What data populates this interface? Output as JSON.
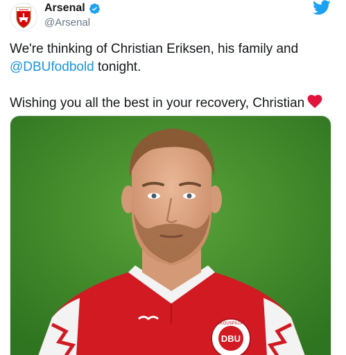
{
  "account": {
    "display_name": "Arsenal",
    "handle": "@Arsenal",
    "avatar_text": "Arsenal"
  },
  "tweet": {
    "line1_text": "We're thinking of Christian Eriksen, his family and",
    "mention": "@DBUfodbold",
    "line2_suffix": " tonight.",
    "line3_text": "Wishing you all the best in your recovery, Christian"
  },
  "media": {
    "badge_text": "DBU",
    "badge_ring_text": "SKOUSPILUN"
  },
  "icons": {
    "verified": "verified-badge-icon",
    "twitter": "twitter-bird-icon",
    "heart": "red-heart-emoji"
  },
  "colors": {
    "twitter_blue": "#1da1f2",
    "mention_blue": "#1b95e0",
    "arsenal_red": "#db0007",
    "shirt_red": "#d11a22",
    "pitch_green": "#3f8a2a",
    "text_primary": "#14171a",
    "text_secondary": "#657786"
  }
}
